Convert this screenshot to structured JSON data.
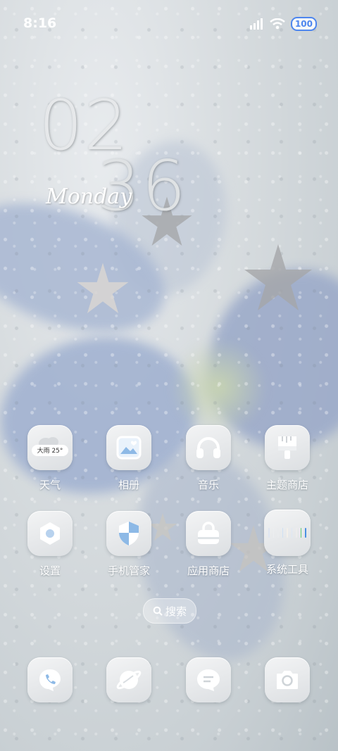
{
  "status_bar": {
    "time": "8:16",
    "battery": "100"
  },
  "clock": {
    "hours": "02",
    "minutes": "36",
    "day": "Monday"
  },
  "apps": [
    {
      "label": "天气",
      "icon": "weather-icon",
      "badge": "大雨 25°"
    },
    {
      "label": "相册",
      "icon": "gallery-icon"
    },
    {
      "label": "音乐",
      "icon": "music-headphones-icon"
    },
    {
      "label": "主题商店",
      "icon": "theme-store-brush-icon"
    },
    {
      "label": "设置",
      "icon": "settings-hex-icon"
    },
    {
      "label": "手机管家",
      "icon": "phone-manager-shield-icon"
    },
    {
      "label": "应用商店",
      "icon": "app-store-bag-icon"
    },
    {
      "label": "系统工具",
      "icon": "system-tools-folder-icon"
    }
  ],
  "search": {
    "label": "搜索"
  },
  "dock": [
    {
      "icon": "phone-icon"
    },
    {
      "icon": "browser-icon"
    },
    {
      "icon": "messages-icon"
    },
    {
      "icon": "camera-icon"
    }
  ]
}
